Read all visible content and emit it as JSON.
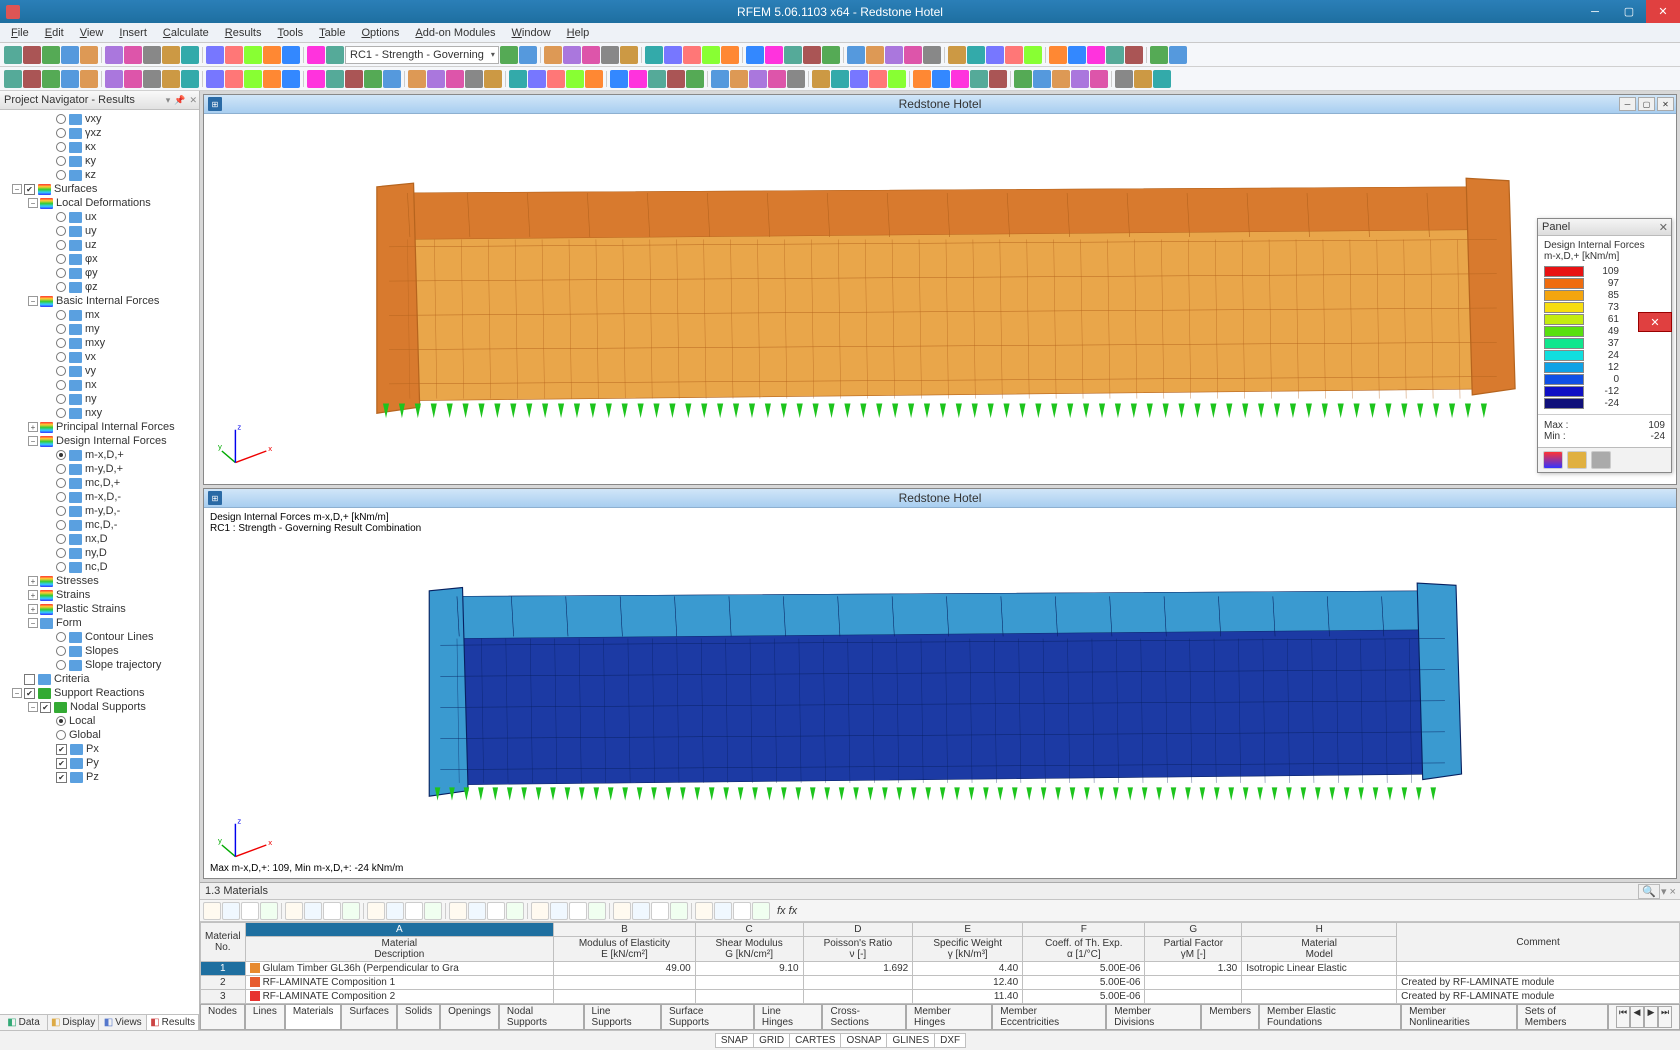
{
  "app_title": "RFEM 5.06.1103 x64 - Redstone Hotel",
  "menu": [
    "File",
    "Edit",
    "View",
    "Insert",
    "Calculate",
    "Results",
    "Tools",
    "Table",
    "Options",
    "Add-on Modules",
    "Window",
    "Help"
  ],
  "toolbar_combo1": "RC1 - Strength - Governing",
  "navigator": {
    "title": "Project Navigator - Results",
    "tabs": {
      "data": "Data",
      "display": "Display",
      "views": "Views",
      "results": "Results"
    },
    "tree": {
      "vxy": "vxy",
      "vxz": "γxz",
      "kx": "κx",
      "ky": "κy",
      "kz": "κz",
      "surfaces": "Surfaces",
      "local_def": "Local Deformations",
      "ux": "ux",
      "uy": "uy",
      "uz": "uz",
      "phix": "φx",
      "phiy": "φy",
      "phiz": "φz",
      "basic_if": "Basic Internal Forces",
      "mx": "mx",
      "my": "my",
      "mxy": "mxy",
      "vx": "vx",
      "vy": "vy",
      "nx": "nx",
      "ny": "ny",
      "nxy": "nxy",
      "principal_if": "Principal Internal Forces",
      "design_if": "Design Internal Forces",
      "mxdp": "m-x,D,+",
      "mydp": "m-y,D,+",
      "mcdp": "mc,D,+",
      "mxdm": "m-x,D,-",
      "mydm": "m-y,D,-",
      "mcdm": "mc,D,-",
      "nxd": "nx,D",
      "nyd": "ny,D",
      "ncd": "nc,D",
      "stresses": "Stresses",
      "strains": "Strains",
      "plastic_strains": "Plastic Strains",
      "form": "Form",
      "contour_lines": "Contour Lines",
      "slopes": "Slopes",
      "slope_traj": "Slope trajectory",
      "criteria": "Criteria",
      "support_reactions": "Support Reactions",
      "nodal_supports": "Nodal Supports",
      "local": "Local",
      "global": "Global",
      "px": "Px",
      "py": "Py",
      "pz": "Pz"
    }
  },
  "viewport1": {
    "title": "Redstone Hotel"
  },
  "viewport2": {
    "title": "Redstone Hotel",
    "overlay_line1": "Design Internal Forces m-x,D,+ [kNm/m]",
    "overlay_line2": "RC1 : Strength - Governing Result Combination",
    "overlay_bottom": "Max m-x,D,+: 109, Min m-x,D,+: -24 kNm/m"
  },
  "panel": {
    "title": "Panel",
    "heading1": "Design Internal Forces",
    "heading2": "m-x,D,+ [kNm/m]",
    "legend": [
      {
        "color": "#e81213",
        "val": "109"
      },
      {
        "color": "#ef6c0f",
        "val": "97"
      },
      {
        "color": "#f4a50f",
        "val": "85"
      },
      {
        "color": "#f7dd0f",
        "val": "73"
      },
      {
        "color": "#c4ec10",
        "val": "61"
      },
      {
        "color": "#59e010",
        "val": "49"
      },
      {
        "color": "#10e68d",
        "val": "37"
      },
      {
        "color": "#10dede",
        "val": "24"
      },
      {
        "color": "#10a2e6",
        "val": "12"
      },
      {
        "color": "#1050e6",
        "val": "0"
      },
      {
        "color": "#1010c4",
        "val": "-12"
      },
      {
        "color": "#10107a",
        "val": "-24"
      }
    ],
    "max_label": "Max :",
    "max_val": "109",
    "min_label": "Min :",
    "min_val": "-24"
  },
  "table": {
    "title": "1.3 Materials",
    "col_letters": [
      "A",
      "B",
      "C",
      "D",
      "E",
      "F",
      "G",
      "H"
    ],
    "headers1": [
      "Material No.",
      "Material",
      "Modulus of Elasticity",
      "Shear Modulus",
      "Poisson's Ratio",
      "Specific Weight",
      "Coeff. of Th. Exp.",
      "Partial Factor",
      "Material",
      ""
    ],
    "headers2": [
      "",
      "Description",
      "E [kN/cm²]",
      "G [kN/cm²]",
      "ν [-]",
      "γ [kN/m³]",
      "α [1/°C]",
      "γM [-]",
      "Model",
      "Comment"
    ],
    "rows": [
      {
        "no": "1",
        "desc": "Glulam Timber GL36h (Perpendicular to Gra",
        "color": "#e78a2f",
        "E": "49.00",
        "G": "9.10",
        "v": "1.692",
        "w": "4.40",
        "a": "5.00E-06",
        "pf": "1.30",
        "model": "Isotropic Linear Elastic",
        "comment": ""
      },
      {
        "no": "2",
        "desc": "RF-LAMINATE Composition 1",
        "color": "#e75d2f",
        "E": "",
        "G": "",
        "v": "",
        "w": "12.40",
        "a": "5.00E-06",
        "pf": "",
        "model": "",
        "comment": "Created by RF-LAMINATE module"
      },
      {
        "no": "3",
        "desc": "RF-LAMINATE Composition 2",
        "color": "#e7322f",
        "E": "",
        "G": "",
        "v": "",
        "w": "11.40",
        "a": "5.00E-06",
        "pf": "",
        "model": "",
        "comment": "Created by RF-LAMINATE module"
      }
    ],
    "tabs": [
      "Nodes",
      "Lines",
      "Materials",
      "Surfaces",
      "Solids",
      "Openings",
      "Nodal Supports",
      "Line Supports",
      "Surface Supports",
      "Line Hinges",
      "Cross-Sections",
      "Member Hinges",
      "Member Eccentricities",
      "Member Divisions",
      "Members",
      "Member Elastic Foundations",
      "Member Nonlinearities",
      "Sets of Members"
    ]
  },
  "status": [
    "SNAP",
    "GRID",
    "CARTES",
    "OSNAP",
    "GLINES",
    "DXF"
  ]
}
